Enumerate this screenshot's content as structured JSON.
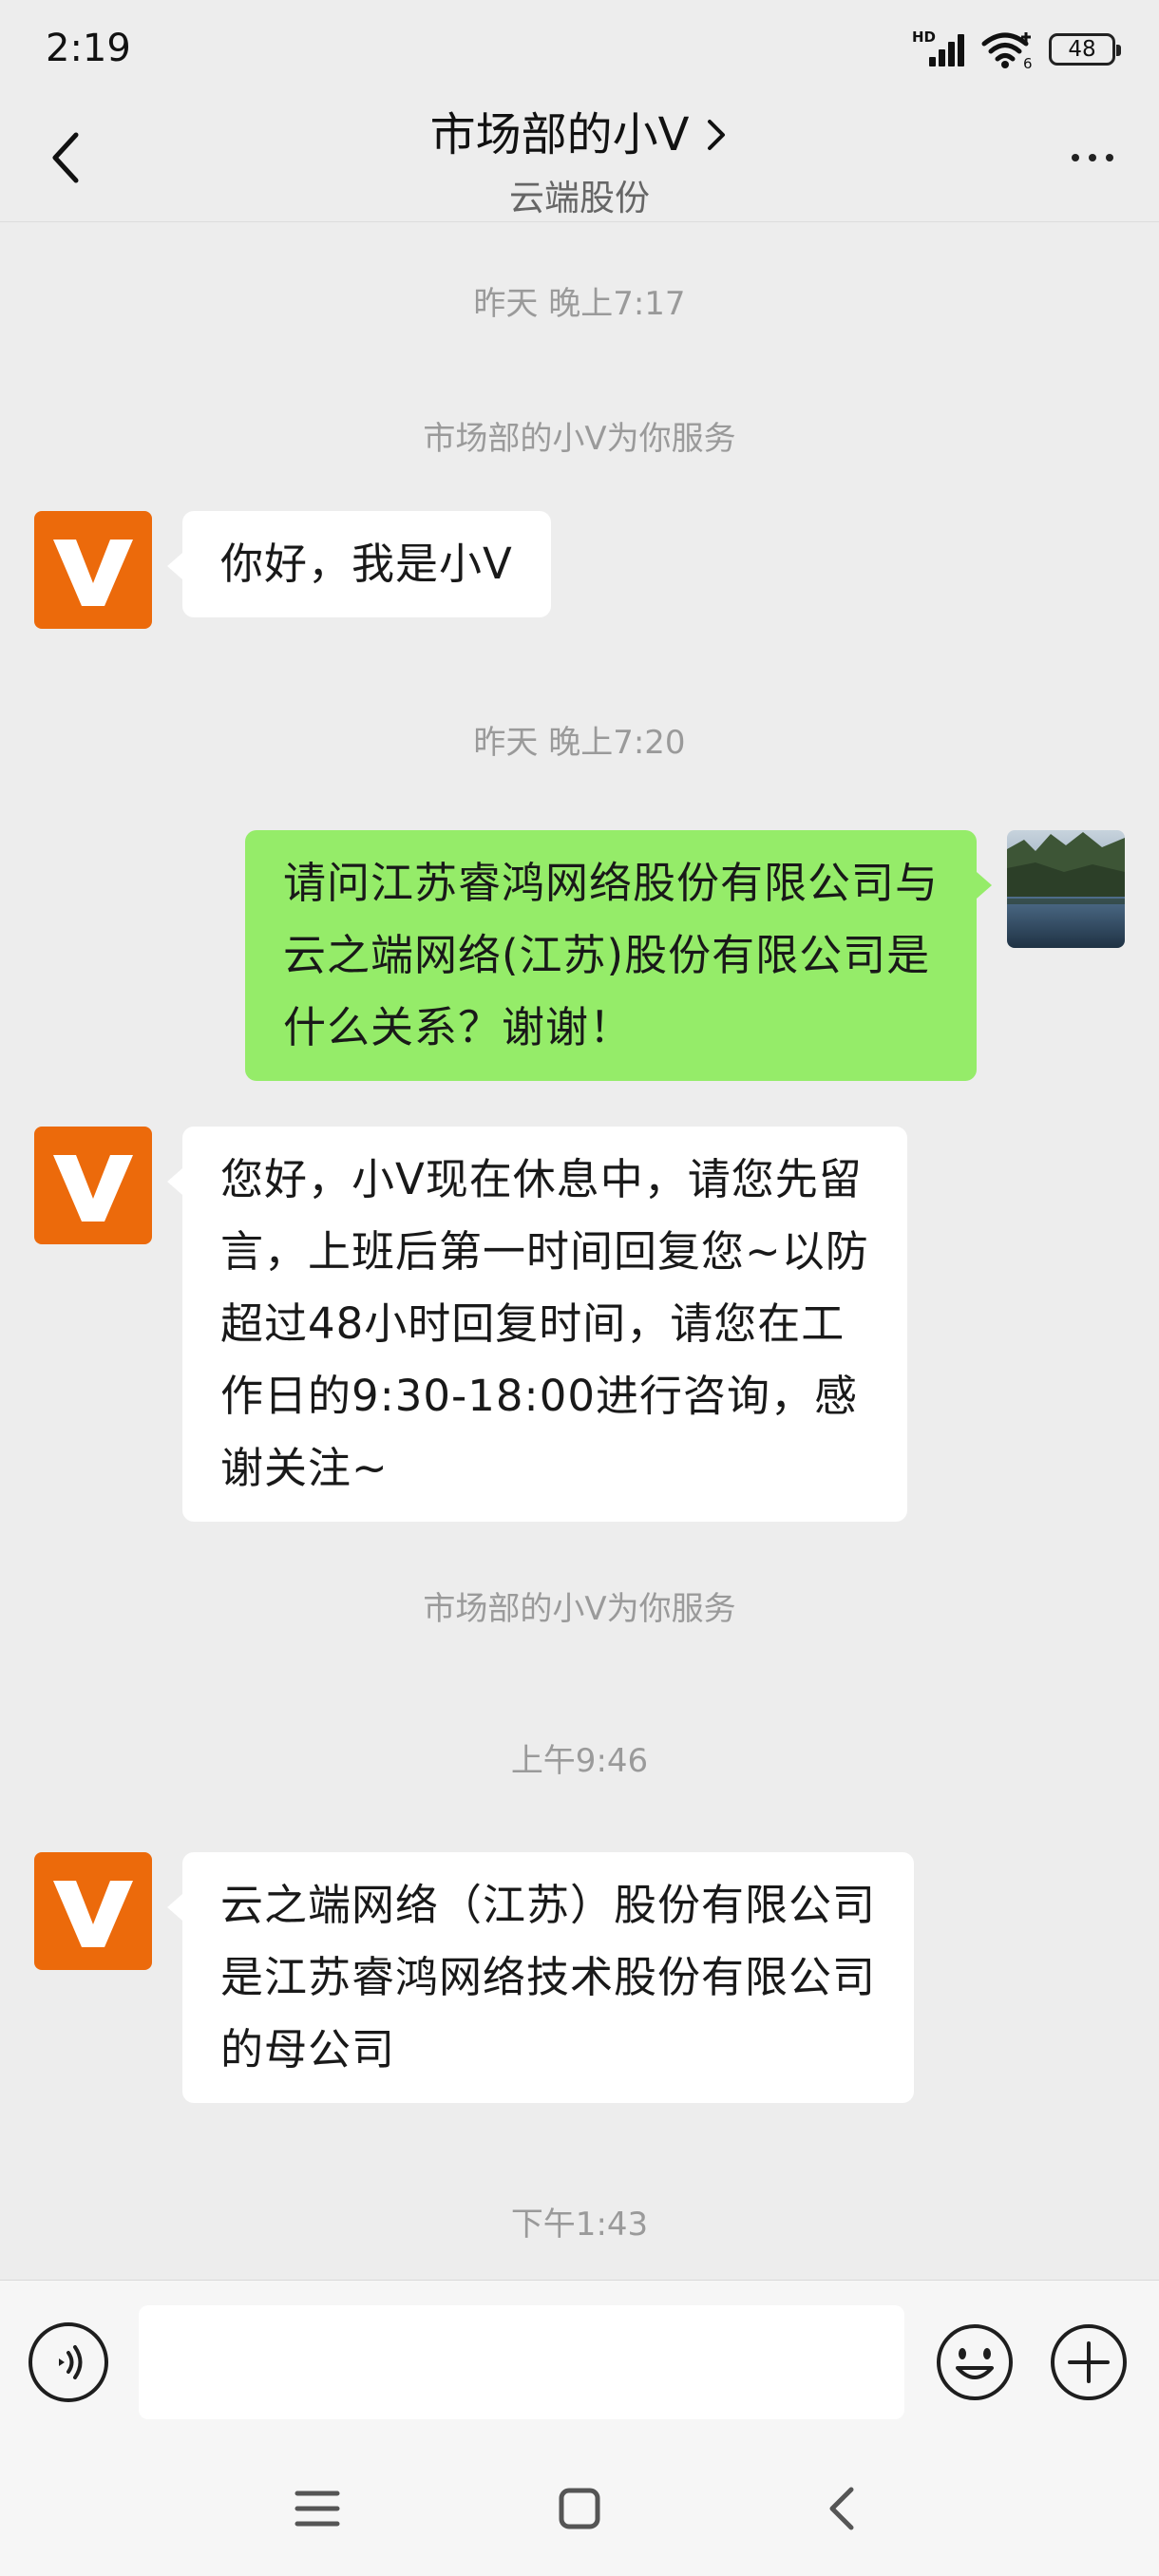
{
  "status_bar": {
    "time": "2:19",
    "network_label": "HD",
    "wifi_badge": "6",
    "battery": "48"
  },
  "header": {
    "title": "市场部的小V",
    "subtitle": "云端股份"
  },
  "colors": {
    "accent_orange": "#ec6a0b",
    "sent_bubble": "#95ec69",
    "received_bubble": "#ffffff",
    "background": "#ededed"
  },
  "chat": {
    "stamps": [
      "昨天 晚上7:17",
      "市场部的小V为你服务",
      "昨天 晚上7:20",
      "市场部的小V为你服务",
      "上午9:46",
      "下午1:43"
    ],
    "messages": [
      {
        "from": "agent",
        "lines": [
          "你好，我是小V"
        ]
      },
      {
        "from": "me",
        "lines": [
          "请问江苏睿鸿网络股份有限公司与",
          "云之端网络(江苏)股份有限公司是",
          "什么关系？谢谢！"
        ]
      },
      {
        "from": "agent",
        "lines": [
          "您好，小V现在休息中，请您先留",
          "言，上班后第一时间回复您~以防",
          "超过48小时回复时间，请您在工",
          "作日的9:30-18:00进行咨询，感",
          "谢关注~"
        ]
      },
      {
        "from": "agent",
        "lines": [
          "云之端网络（江苏）股份有限公司",
          "是江苏睿鸿网络技术股份有限公司",
          "的母公司"
        ]
      }
    ]
  },
  "input_bar": {
    "placeholder": "",
    "voice_icon": "voice-icon",
    "emoji_icon": "emoji-icon",
    "plus_icon": "plus-icon"
  }
}
